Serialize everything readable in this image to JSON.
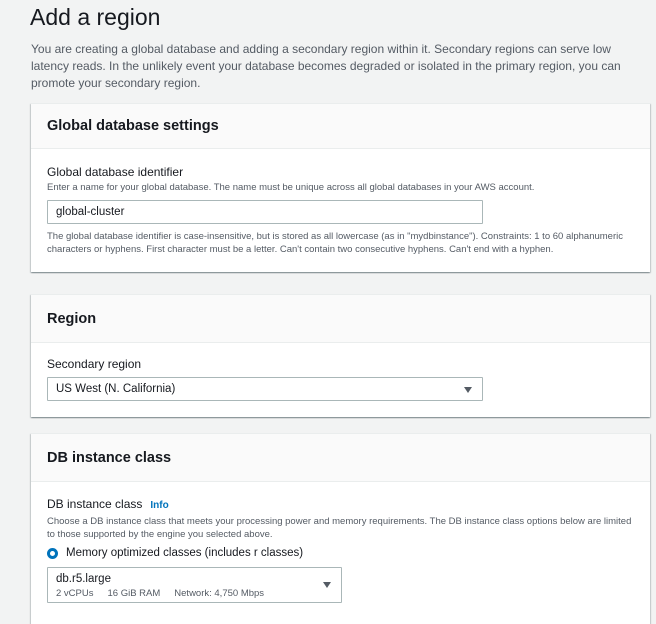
{
  "page": {
    "title": "Add a region",
    "intro": "You are creating a global database and adding a secondary region within it. Secondary regions can serve low latency reads. In the unlikely event your database becomes degraded or isolated in the primary region, you can promote your secondary region."
  },
  "global_settings": {
    "header": "Global database settings",
    "identifier_label": "Global database identifier",
    "identifier_desc": "Enter a name for your global database. The name must be unique across all global databases in your AWS account.",
    "identifier_value": "global-cluster",
    "identifier_constraints": "The global database identifier is case-insensitive, but is stored as all lowercase (as in \"mydbinstance\"). Constraints: 1 to 60 alphanumeric characters or hyphens. First character must be a letter. Can't contain two consecutive hyphens. Can't end with a hyphen."
  },
  "region": {
    "header": "Region",
    "secondary_label": "Secondary region",
    "secondary_value": "US West (N. California)"
  },
  "db_instance": {
    "header": "DB instance class",
    "label": "DB instance class",
    "info_link": "Info",
    "desc": "Choose a DB instance class that meets your processing power and memory requirements. The DB instance class options below are limited to those supported by the engine you selected above.",
    "radio_label": "Memory optimized classes (includes r classes)",
    "selected": {
      "name": "db.r5.large",
      "vcpus": "2 vCPUs",
      "ram": "16 GiB RAM",
      "network": "Network: 4,750 Mbps"
    }
  },
  "colors": {
    "background": "#f2f3f3",
    "accent": "#0073bb",
    "text": "#16191f",
    "secondary_text": "#545b64"
  }
}
